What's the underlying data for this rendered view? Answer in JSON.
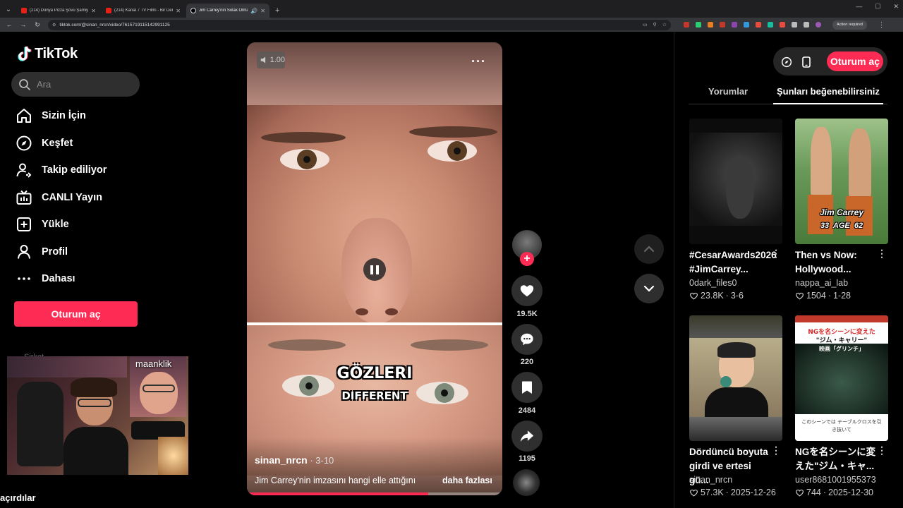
{
  "browser": {
    "tabs": [
      {
        "label": "(214) Dünya Pizza Şovu Şamiyel"
      },
      {
        "label": "(214) Kanal 7 TV Filmi - Bir Den"
      },
      {
        "label": "Jim Carrey'nin Solak Olmas"
      }
    ],
    "url": "tiktok.com/@sinan_nrcn/video/7615719115142991125",
    "action_required": "Action required"
  },
  "sidebar": {
    "logo": "TikTok",
    "search_placeholder": "Ara",
    "nav": [
      {
        "label": "Sizin İçin",
        "icon": "home-icon"
      },
      {
        "label": "Keşfet",
        "icon": "compass-icon"
      },
      {
        "label": "Takip ediliyor",
        "icon": "following-icon"
      },
      {
        "label": "CANLI Yayın",
        "icon": "live-tv-icon"
      },
      {
        "label": "Yükle",
        "icon": "upload-icon"
      },
      {
        "label": "Profil",
        "icon": "profile-icon"
      },
      {
        "label": "Dahası",
        "icon": "more-icon"
      }
    ],
    "login_label": "Oturum aç",
    "faded_label": "Sirket"
  },
  "overlay": {
    "webcam_name": "maanklik",
    "bottom_text": "açırdılar"
  },
  "video": {
    "volume": "1.00",
    "caption_line1": "GÖZLERI",
    "caption_line2": "DIFFERENT",
    "author": "sinan_nrcn",
    "date": " · 3-10",
    "description": "Jim Carrey'nin imzasını hangi elle attığını",
    "more": "daha fazlası",
    "progress": 0.71
  },
  "actions": {
    "likes": "19.5K",
    "comments": "220",
    "saves": "2484",
    "shares": "1195"
  },
  "right_panel": {
    "login_label": "Oturum aç",
    "tabs": [
      "Yorumlar",
      "Şunları beğenebilirsiniz"
    ],
    "active_tab": 1,
    "cards": [
      {
        "title": "#CesarAwards2026 #JimCarrey...",
        "user": "0dark_files0",
        "likes": "23.8K",
        "date": "3-6"
      },
      {
        "title": "Then vs Now: Hollywood...",
        "user": "nappa_ai_lab",
        "likes": "1504",
        "date": "1-28",
        "thumb_text": "Jim Carrey",
        "thumb_sub": "33  AGE  62"
      },
      {
        "title": "Dördüncü boyuta girdi ve ertesi gü...",
        "user": "sinan_nrcn",
        "likes": "57.3K",
        "date": "2025-12-26"
      },
      {
        "title": "NGを名シーンに変えた\"ジム・キャ...",
        "user": "user8681001955373",
        "likes": "744",
        "date": "2025-12-30",
        "thumb_text": "NGを名シーンに変えた",
        "thumb_sub": "\"ジム・キャリー\"",
        "thumb_film": "映画「グリンチ」",
        "thumb_caption": "このシーンでは テーブルクロスを引き抜いて"
      }
    ]
  },
  "colors": {
    "accent": "#fe2c55",
    "background": "#000000"
  }
}
